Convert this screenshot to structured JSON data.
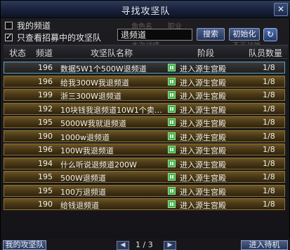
{
  "window": {
    "title": "寻找攻坚队",
    "close_glyph": "✕"
  },
  "filters": {
    "my_channel": {
      "label": "我的频道",
      "checked": false
    },
    "recruiting_only": {
      "label": "只查看招募中的攻坚队",
      "checked": true
    }
  },
  "search": {
    "value": "退频道",
    "search_label": "搜索",
    "reset_label": "初始化",
    "refresh_glyph": "↻"
  },
  "background_text": {
    "a": "角色名",
    "b": "职业",
    "c": "本次战绩",
    "d": "不灭战神"
  },
  "table": {
    "headers": {
      "status": "状态",
      "channel": "频道",
      "name": "攻坚队名称",
      "stage": "阶段",
      "count": "队员数量"
    },
    "rows": [
      {
        "channel": "196",
        "name": "数据5W1个500W退频道",
        "stage": "进入源生宫殿",
        "count": "1/8",
        "selected": true
      },
      {
        "channel": "196",
        "name": "给我300W我退频道",
        "stage": "进入源生宫殿",
        "count": "1/8"
      },
      {
        "channel": "199",
        "name": "浙三300W退频道",
        "stage": "进入源生宫殿",
        "count": "1/8"
      },
      {
        "channel": "192",
        "name": "10块钱我退频道10W1个卖…",
        "stage": "进入源生宫殿",
        "count": "1/8"
      },
      {
        "channel": "195",
        "name": "5000W我就退频道",
        "stage": "进入源生宫殿",
        "count": "1/8"
      },
      {
        "channel": "190",
        "name": "1000w退频道",
        "stage": "进入源生宫殿",
        "count": "1/8"
      },
      {
        "channel": "196",
        "name": "100W我退频道",
        "stage": "进入源生宫殿",
        "count": "1/8"
      },
      {
        "channel": "194",
        "name": "什么听说退频道200W",
        "stage": "进入源生宫殿",
        "count": "1/8"
      },
      {
        "channel": "195",
        "name": "500W退频道",
        "stage": "进入源生宫殿",
        "count": "1/8"
      },
      {
        "channel": "195",
        "name": "100万退频道",
        "stage": "进入源生宫殿",
        "count": "1/8"
      },
      {
        "channel": "190",
        "name": "给钱退频道",
        "stage": "进入源生宫殿",
        "count": "1/8"
      }
    ]
  },
  "footer": {
    "left_button": "我的攻坚队",
    "page": "1 / 3",
    "prev_glyph": "◀",
    "next_glyph": "▶",
    "right_button": "进入待机"
  },
  "colors": {
    "row_gold": "#6b5524",
    "row_selected_border": "#58a4c6",
    "stage_icon": "#3fb14a"
  }
}
